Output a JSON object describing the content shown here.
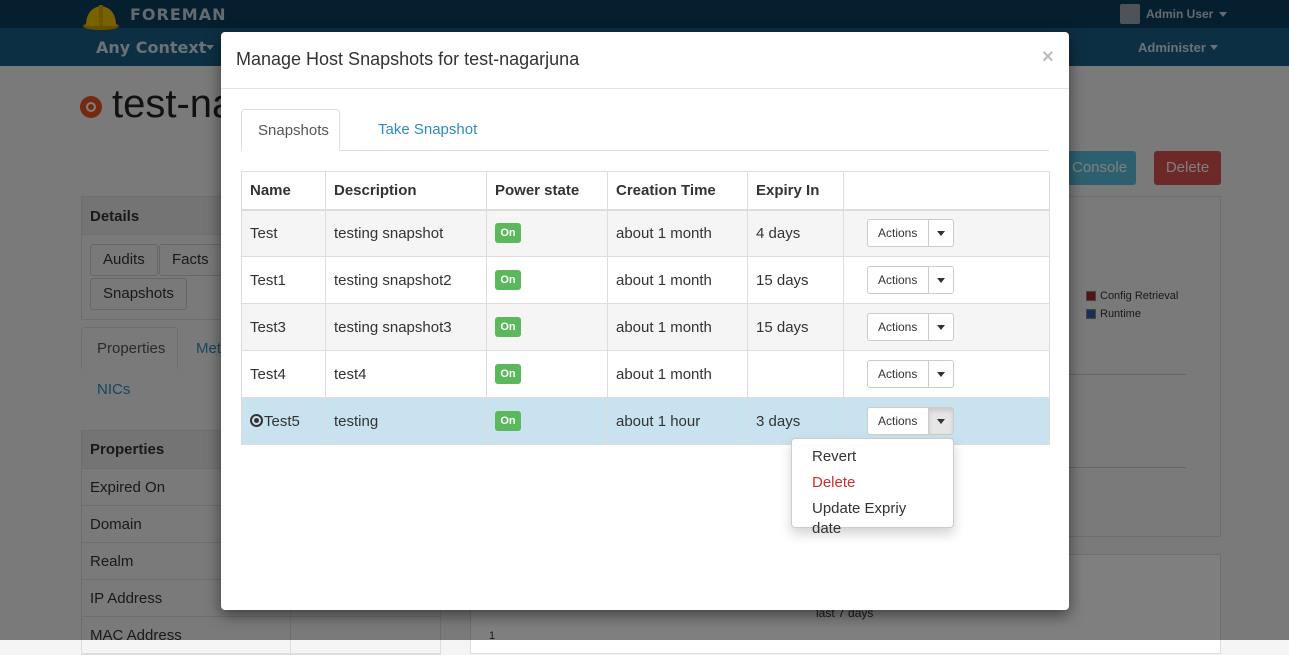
{
  "topbar": {
    "brand": "FOREMAN",
    "context": "Any Context",
    "user": "Admin User",
    "administer": "Administer"
  },
  "page": {
    "host_title": "test-na",
    "console_button": "Console",
    "delete_button": "Delete",
    "details_heading": "Details",
    "detail_buttons": [
      "Audits",
      "Facts",
      "Snapshots"
    ],
    "tabs": [
      "Properties",
      "Met"
    ],
    "nics_tab": "NICs",
    "properties_heading": "Properties",
    "property_rows": [
      "Expired On",
      "Domain",
      "Realm",
      "IP Address",
      "MAC Address"
    ],
    "legend": [
      "Config Retrieval",
      "Runtime"
    ],
    "chart_caption": "last 7 days",
    "chart_tick": "1"
  },
  "modal": {
    "title": "Manage Host Snapshots for test-nagarjuna",
    "close_glyph": "×",
    "tabs": [
      "Snapshots",
      "Take Snapshot"
    ],
    "columns": [
      "Name",
      "Description",
      "Power state",
      "Creation Time",
      "Expiry In",
      ""
    ],
    "rows": [
      {
        "name": "Test",
        "description": "testing snapshot",
        "power": "On",
        "created": "about 1 month",
        "expiry": "4 days",
        "action": "Actions"
      },
      {
        "name": "Test1",
        "description": "testing snapshot2",
        "power": "On",
        "created": "about 1 month",
        "expiry": "15 days",
        "action": "Actions"
      },
      {
        "name": "Test3",
        "description": "testing snapshot3",
        "power": "On",
        "created": "about 1 month",
        "expiry": "15 days",
        "action": "Actions"
      },
      {
        "name": "Test4",
        "description": "test4",
        "power": "On",
        "created": "about 1 month",
        "expiry": "",
        "action": "Actions"
      },
      {
        "name": "Test5",
        "description": "testing",
        "power": "On",
        "created": "about 1 hour",
        "expiry": "3 days",
        "action": "Actions"
      }
    ],
    "dropdown": [
      "Revert",
      "Delete",
      "Update Expriy date"
    ]
  },
  "colors": {
    "topbar": "#1a5e86",
    "link": "#2a8dc4",
    "power_on": "#5cb85c",
    "selected_row": "#c8e3ef",
    "danger": "#c9302c"
  }
}
